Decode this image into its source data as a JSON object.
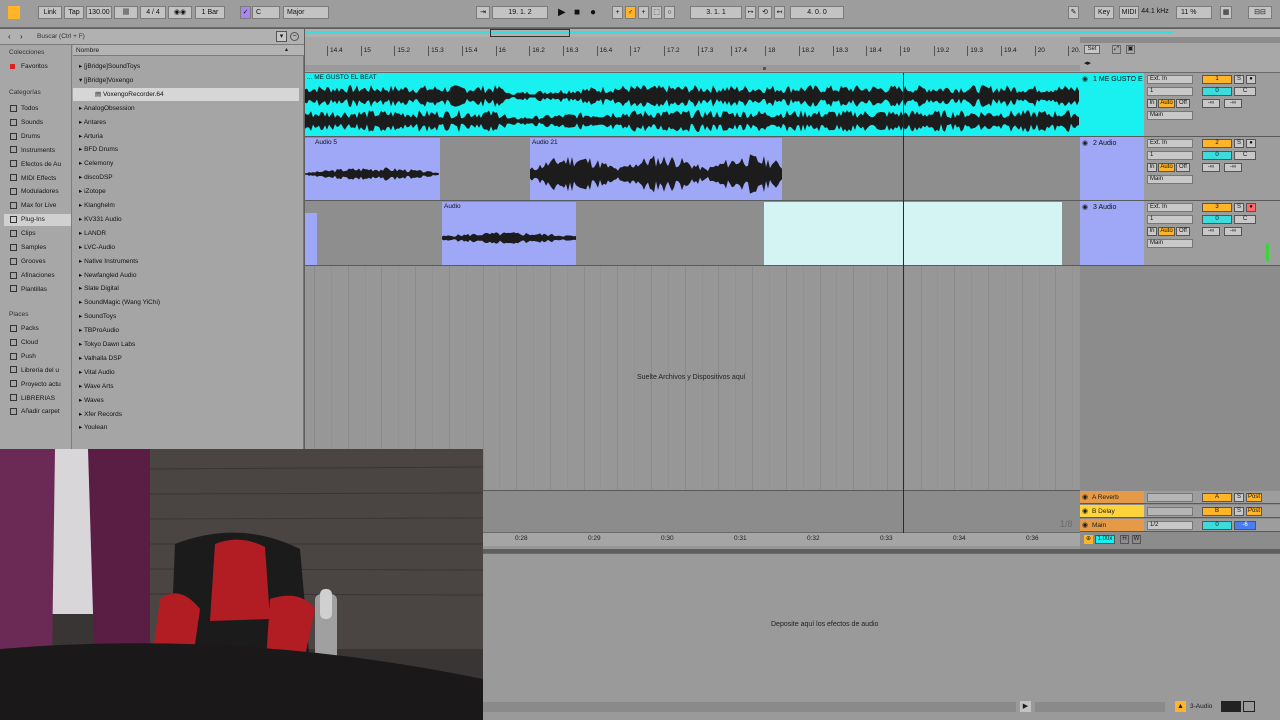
{
  "topbar": {
    "link": "Link",
    "tap": "Tap",
    "tempo": "130.00",
    "signature": "4 / 4",
    "quantize": "1 Bar",
    "key_root": "C",
    "scale": "Major",
    "position": "19. 1. 2",
    "loop_start": "3. 1. 1",
    "loop_length": "4. 0. 0",
    "key_label": "Key",
    "midi_label": "MIDI",
    "sample_rate": "44.1 kHz",
    "cpu": "11 %"
  },
  "browser": {
    "search_placeholder": "Buscar (Ctrl + F)",
    "collections_header": "Colecciones",
    "favorites": "Favoritos",
    "categories_header": "Categorías",
    "categories": [
      "Todos",
      "Sounds",
      "Drums",
      "Instruments",
      "Efectos de Au",
      "MIDI Effects",
      "Moduladores",
      "Max for Live",
      "Plug-Ins",
      "Clips",
      "Samples",
      "Grooves",
      "Afinaciones",
      "Plantillas"
    ],
    "places_header": "Places",
    "places": [
      "Packs",
      "Cloud",
      "Push",
      "Librería del u",
      "Proyecto actu",
      "LIBRERIAS",
      "Añadir carpet"
    ],
    "name_header": "Nombre",
    "files": [
      "[jBridge]SoundToys",
      "[jBridge]Voxengo",
      "VoxengoRecorder.64",
      "AnalogObsession",
      "Antares",
      "Arturia",
      "BFD Drums",
      "Celemony",
      "discoDSP",
      "iZotope",
      "Klanghelm",
      "KV331 Audio",
      "LANDR",
      "LVC-Audio",
      "Native Instruments",
      "Newfangled Audio",
      "Slate Digital",
      "SoundMagic (Wang YiChi)",
      "SoundToys",
      "TBProAudio",
      "Tokyo Dawn Labs",
      "Valhalla DSP",
      "Vital Audio",
      "Wave Arts",
      "Waves",
      "Xfer Records",
      "Youlean"
    ]
  },
  "ruler": {
    "bars": [
      "14.4",
      "15",
      "15.2",
      "15.3",
      "15.4",
      "16",
      "16.2",
      "16.3",
      "16.4",
      "17",
      "17.2",
      "17.3",
      "17.4",
      "18",
      "18.2",
      "18.3",
      "18.4",
      "19",
      "19.2",
      "19.3",
      "19.4",
      "20",
      "20.2"
    ],
    "set_label": "Set",
    "times": [
      "0:28",
      "0:29",
      "0:30",
      "0:31",
      "0:32",
      "0:33",
      "0:34",
      "0:36"
    ],
    "grid": "1/8"
  },
  "tracks": [
    {
      "number": "1",
      "name": "1 ME GUSTO E",
      "clip": "... ME GUSTO EL BEAT",
      "input": "Ext. In",
      "channel": "1",
      "output": "Main"
    },
    {
      "number": "2",
      "name": "2 Audio",
      "clips": [
        "Audio 5",
        "Audio 21"
      ],
      "input": "Ext. In",
      "channel": "1",
      "output": "Main"
    },
    {
      "number": "3",
      "name": "3 Audio",
      "clip": "Audio",
      "input": "Ext. In",
      "channel": "1",
      "output": "Main"
    }
  ],
  "io_labels": {
    "in": "In",
    "auto": "Auto",
    "off": "Off",
    "minus_inf": "-∞",
    "center": "C",
    "zero": "0",
    "s": "S"
  },
  "returns": [
    {
      "letter": "A",
      "name": "A Reverb",
      "post": "Post"
    },
    {
      "letter": "B",
      "name": "B Delay",
      "post": "Post"
    }
  ],
  "main": {
    "name": "Main",
    "output": "1/2",
    "zero": "0",
    "vol": "-6"
  },
  "zoom": "1.00x",
  "hw_labels": [
    "H",
    "W"
  ],
  "drop_arrangement": "Suelte Archivos y Dispositivos aquí",
  "drop_devices": "Deposite aquí los efectos de audio",
  "statusbar": {
    "track": "3-Audio"
  },
  "colors": {
    "cyan": "#19f0f0",
    "blue": "#9ea8f6",
    "yellow": "#ffb527",
    "orange": "#e59a48"
  }
}
